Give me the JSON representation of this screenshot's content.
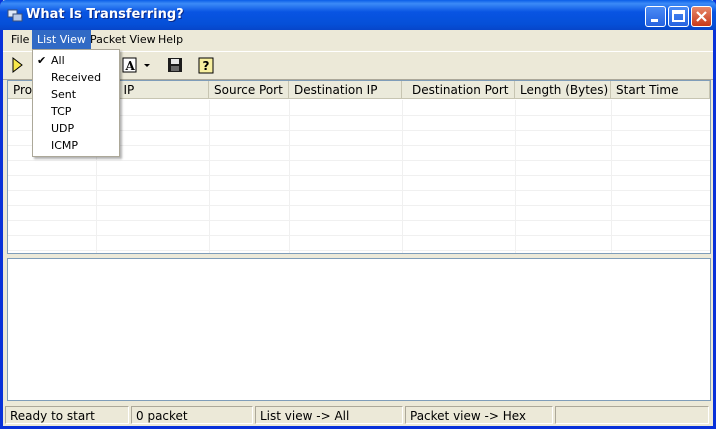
{
  "window": {
    "title": "What Is Transferring?"
  },
  "menubar": {
    "items": [
      {
        "label": "File"
      },
      {
        "label": "List View"
      },
      {
        "label": "Packet View"
      },
      {
        "label": "Help"
      }
    ]
  },
  "list_view_menu": {
    "items": [
      {
        "label": "All",
        "checked": true
      },
      {
        "label": "Received",
        "checked": false
      },
      {
        "label": "Sent",
        "checked": false
      },
      {
        "label": "TCP",
        "checked": false
      },
      {
        "label": "UDP",
        "checked": false
      },
      {
        "label": "ICMP",
        "checked": false
      }
    ]
  },
  "toolbar": {
    "icons": [
      "start-icon",
      "font-icon",
      "dropdown-arrow-icon",
      "save-icon",
      "help-icon"
    ],
    "font_glyph": "A"
  },
  "list": {
    "columns": [
      "Protocol",
      "Source IP",
      "Source Port",
      "Destination IP",
      "Destination Port",
      "Length (Bytes)",
      "Start Time"
    ],
    "columns_visible": [
      "Prot",
      "rce IP",
      "Source Port",
      "Destination IP",
      "Destination Port",
      "Length (Bytes)",
      "Start Time"
    ]
  },
  "status": {
    "state": "Ready to start",
    "packets": "0 packet",
    "list_view": "List view -> All",
    "packet_view": "Packet view -> Hex",
    "extra": ""
  },
  "colors": {
    "title_bar": "#0854e3",
    "menu_highlight": "#316ac5",
    "window_bg": "#ece9d8"
  }
}
